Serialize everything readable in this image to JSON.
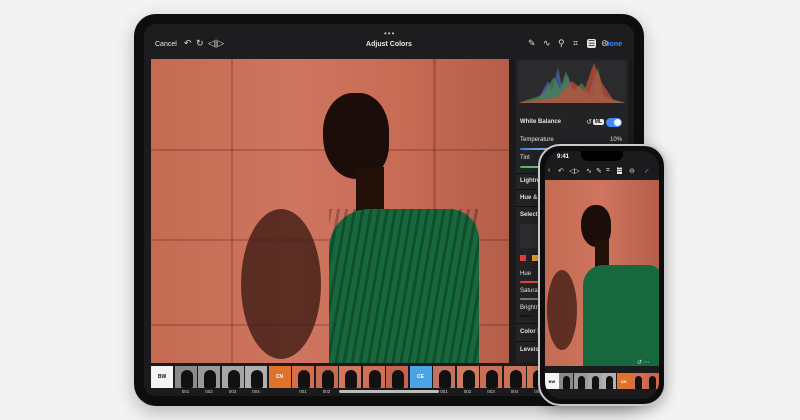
{
  "ipad": {
    "topbar": {
      "dots": "•••",
      "cancel_label": "Cancel",
      "title": "Adjust Colors",
      "done_label": "Done",
      "icons": [
        "undo-icon",
        "redo-icon",
        "compare-icon",
        "brush-icon",
        "curves-icon",
        "eyedropper-icon",
        "crop-icon",
        "adjustments-icon",
        "more-icon"
      ]
    },
    "panel": {
      "white_balance": {
        "label": "White Balance",
        "ml_badge": "ML",
        "enabled": true,
        "temperature": {
          "label": "Temperature",
          "value": "10%"
        },
        "tint": {
          "label": "Tint",
          "value": "0%"
        }
      },
      "sections": [
        "Lightne",
        "Hue & S",
        "Selectiv"
      ],
      "selective": {
        "hue_label": "Hue",
        "saturation_label": "Saturati",
        "brightness_label": "Brightn"
      },
      "bottom_sections": [
        "Color B",
        "Levels"
      ]
    },
    "filmstrip": {
      "tiles": [
        {
          "label": "BW",
          "color": "#f4f4f4",
          "text": "#111"
        },
        {
          "label": "",
          "num": "001",
          "color": "#8a8a8a"
        },
        {
          "label": "",
          "num": "002",
          "color": "#9a9a9a"
        },
        {
          "label": "",
          "num": "003",
          "color": "#a6a6a6"
        },
        {
          "label": "",
          "num": "004",
          "color": "#b0b0b0"
        },
        {
          "label": "CN",
          "color": "#e0732c",
          "text": "#fff"
        },
        {
          "label": "",
          "num": "001",
          "color": "#d66d4c"
        },
        {
          "label": "",
          "num": "002",
          "color": "#c86a50"
        },
        {
          "label": "",
          "num": "003",
          "color": "#d2765e"
        },
        {
          "label": "",
          "num": "004",
          "color": "#cf6f55"
        },
        {
          "label": "",
          "num": "005",
          "color": "#c5644c"
        },
        {
          "label": "CE",
          "color": "#4ba3e3",
          "text": "#fff"
        },
        {
          "label": "",
          "num": "001",
          "color": "#c57260"
        },
        {
          "label": "",
          "num": "002",
          "color": "#d07c61"
        },
        {
          "label": "",
          "num": "003",
          "color": "#c96e57"
        },
        {
          "label": "",
          "num": "004",
          "color": "#cd7259"
        },
        {
          "label": "",
          "num": "005",
          "color": "#d57a5a"
        },
        {
          "label": "MF",
          "color": "#f2a33a",
          "text": "#fff"
        },
        {
          "label": "",
          "num": "",
          "color": "#c7684f"
        },
        {
          "label": "",
          "num": "",
          "color": "#cf7259"
        }
      ]
    }
  },
  "iphone": {
    "time": "9:41",
    "toolbar_icons": [
      "back-icon",
      "undo-icon",
      "compare-icon",
      "curves-icon",
      "brush-icon",
      "crop-icon",
      "adjustments-icon",
      "more-icon",
      "done-check-icon"
    ],
    "strip": [
      {
        "label": "BW",
        "color": "#f4f4f4",
        "text": "#111"
      },
      {
        "label": "",
        "color": "#8a8a8a"
      },
      {
        "label": "",
        "color": "#9a9a9a"
      },
      {
        "label": "",
        "color": "#a6a6a6"
      },
      {
        "label": "",
        "color": "#b0b0b0"
      },
      {
        "label": "CN",
        "color": "#e0732c",
        "text": "#fff"
      },
      {
        "label": "",
        "color": "#d66d4c"
      },
      {
        "label": "",
        "color": "#c86a50"
      }
    ]
  }
}
